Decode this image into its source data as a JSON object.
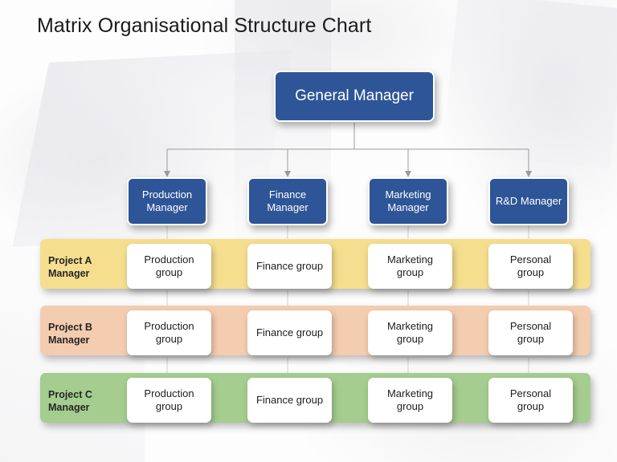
{
  "slide": {
    "title": "Matrix Organisational Structure Chart",
    "background_color": "#fdfdfd"
  },
  "palette": {
    "node_blue": "#2e5597",
    "node_text": "#ffffff",
    "card_white": "#ffffff",
    "card_text": "#1d1d1d",
    "band_project_a": "#f5de8e",
    "band_project_b": "#f4ccb0",
    "band_project_c": "#a5cd8f",
    "connector_line": "#9a9a9a",
    "title_text": "#1b1b1b"
  },
  "top": {
    "general_manager": "General Manager"
  },
  "managers": [
    {
      "label": "Production Manager",
      "line1": "Production",
      "line2": "Manager"
    },
    {
      "label": "Finance Manager",
      "line1": "Finance",
      "line2": "Manager"
    },
    {
      "label": "Marketing Manager",
      "line1": "Marketing",
      "line2": "Manager"
    },
    {
      "label": "R&D Manager",
      "line1": "R&D Manager",
      "line2": ""
    }
  ],
  "rows": [
    {
      "label": "Project A Manager",
      "line1": "Project A",
      "line2": "Manager",
      "color": "#f5de8e",
      "cells": [
        {
          "label": "Production group",
          "line1": "Production",
          "line2": "group"
        },
        {
          "label": "Finance group",
          "line1": "Finance group",
          "line2": ""
        },
        {
          "label": "Marketing group",
          "line1": "Marketing",
          "line2": "group"
        },
        {
          "label": "Personal group",
          "line1": "Personal",
          "line2": "group"
        }
      ]
    },
    {
      "label": "Project B Manager",
      "line1": "Project B",
      "line2": "Manager",
      "color": "#f4ccb0",
      "cells": [
        {
          "label": "Production group",
          "line1": "Production",
          "line2": "group"
        },
        {
          "label": "Finance group",
          "line1": "Finance group",
          "line2": ""
        },
        {
          "label": "Marketing group",
          "line1": "Marketing",
          "line2": "group"
        },
        {
          "label": "Personal group",
          "line1": "Personal",
          "line2": "group"
        }
      ]
    },
    {
      "label": "Project C Manager",
      "line1": "Project C",
      "line2": "Manager",
      "color": "#a5cd8f",
      "cells": [
        {
          "label": "Production group",
          "line1": "Production",
          "line2": "group"
        },
        {
          "label": "Finance group",
          "line1": "Finance group",
          "line2": ""
        },
        {
          "label": "Marketing group",
          "line1": "Marketing",
          "line2": "group"
        },
        {
          "label": "Personal group",
          "line1": "Personal",
          "line2": "group"
        }
      ]
    }
  ]
}
